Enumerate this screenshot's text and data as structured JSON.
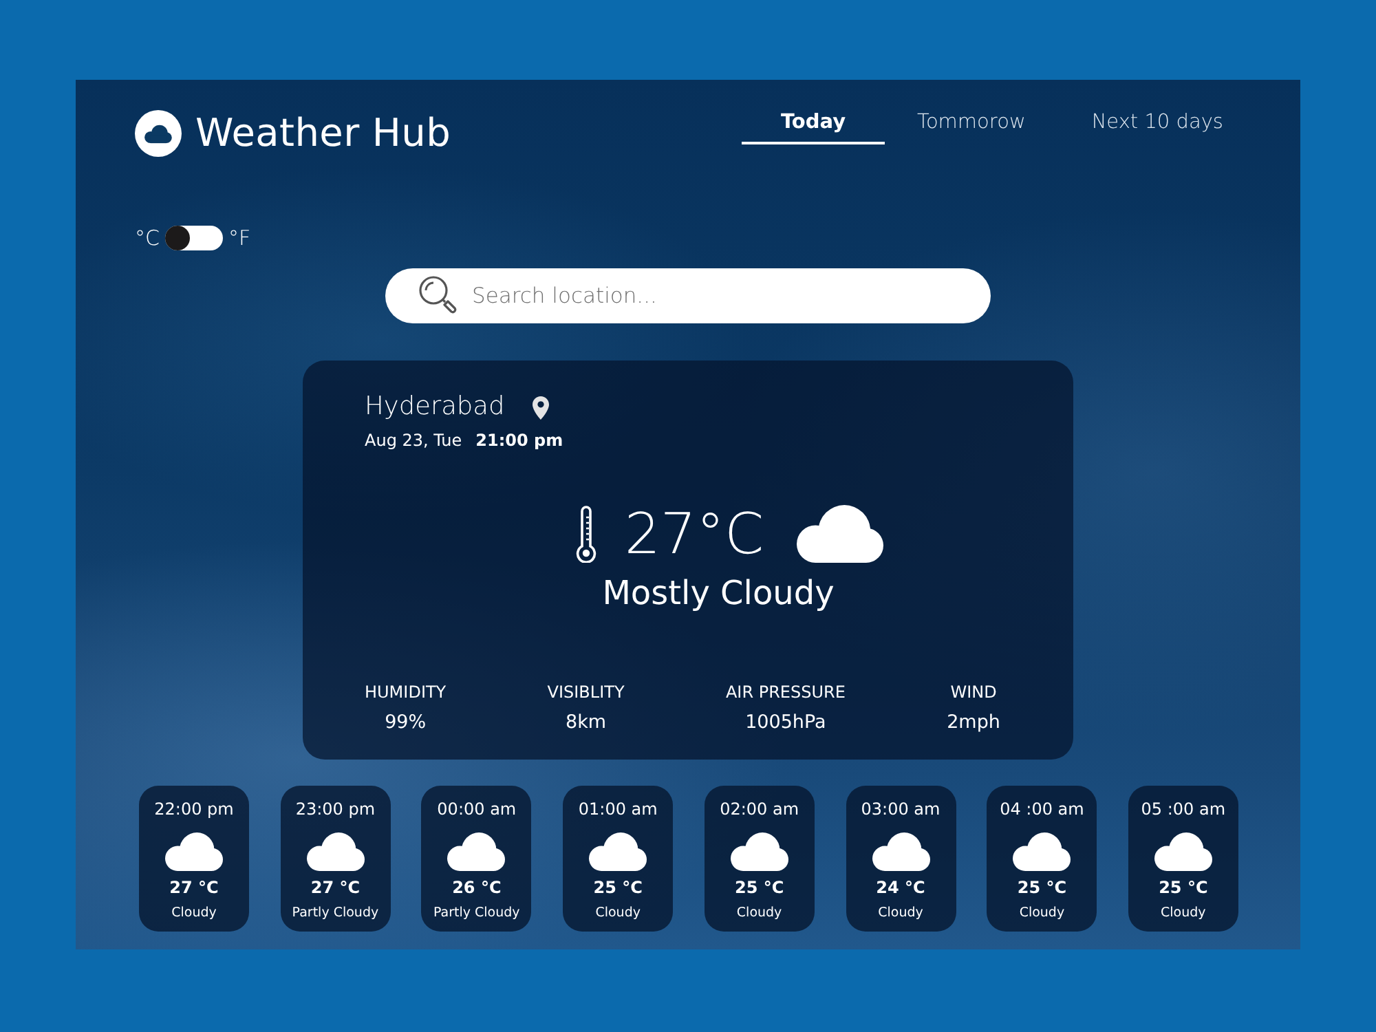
{
  "app": {
    "title": "Weather Hub"
  },
  "tabs": [
    {
      "label": "Today",
      "selected": true
    },
    {
      "label": "Tommorow",
      "selected": false
    },
    {
      "label": "Next 10 days",
      "selected": false
    }
  ],
  "unit_toggle": {
    "left_label": "°C",
    "right_label": "°F",
    "on": false
  },
  "search": {
    "placeholder": "Search location..."
  },
  "current": {
    "city": "Hyderabad",
    "date": "Aug 23, Tue",
    "time": "21:00 pm",
    "temperature": "27°C",
    "condition": "Mostly Cloudy",
    "stats": [
      {
        "label": "HUMIDITY",
        "value": "99%"
      },
      {
        "label": "VISIBLITY",
        "value": "8km"
      },
      {
        "label": "AIR PRESSURE",
        "value": "1005hPa"
      },
      {
        "label": "WIND",
        "value": "2mph"
      }
    ]
  },
  "hourly": [
    {
      "time": "22:00 pm",
      "temperature": "27 °C",
      "condition": "Cloudy"
    },
    {
      "time": "23:00 pm",
      "temperature": "27 °C",
      "condition": "Partly Cloudy"
    },
    {
      "time": "00:00 am",
      "temperature": "26 °C",
      "condition": "Partly Cloudy"
    },
    {
      "time": "01:00 am",
      "temperature": "25 °C",
      "condition": "Cloudy"
    },
    {
      "time": "02:00 am",
      "temperature": "25 °C",
      "condition": "Cloudy"
    },
    {
      "time": "03:00 am",
      "temperature": "24 °C",
      "condition": "Cloudy"
    },
    {
      "time": "04 :00 am",
      "temperature": "25 °C",
      "condition": "Cloudy"
    },
    {
      "time": "05 :00 am",
      "temperature": "25 °C",
      "condition": "Cloudy"
    }
  ]
}
